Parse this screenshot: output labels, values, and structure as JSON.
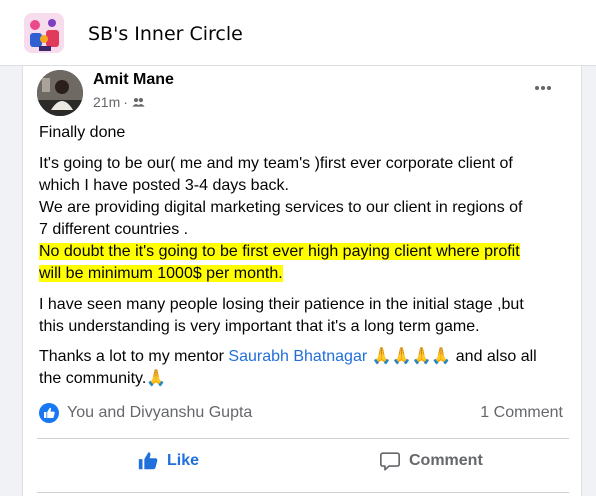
{
  "group": {
    "name": "SB's Inner Circle",
    "logo_icon": "group-illustration-icon"
  },
  "post": {
    "author": "Amit Mane",
    "time": "21m",
    "privacy_icon": "group-members-icon",
    "lines": [
      [
        {
          "t": "Finally done"
        }
      ],
      [
        {
          "t": "It's going to be our( me and my team's )first ever corporate client of"
        }
      ],
      [
        {
          "t": "which I have posted 3-4 days back."
        }
      ],
      [
        {
          "t": "We are providing digital marketing services to our client in regions of"
        }
      ],
      [
        {
          "t": "7 different countries ."
        }
      ],
      [
        {
          "t": "No doubt the it's going to be first ever high paying client where profit",
          "h": true
        }
      ],
      [
        {
          "t": "will be minimum 1000$ per month.",
          "h": true
        }
      ],
      [
        {
          "t": "I have seen many people losing their patience in the initial stage ,but"
        }
      ],
      [
        {
          "t": "this understanding is very important that it's a long term game."
        }
      ],
      [
        {
          "t": "Thanks a lot to my mentor  "
        },
        {
          "t": "Saurabh Bhatnagar",
          "m": true
        },
        {
          "t": "  🙏🙏🙏🙏  and also all"
        }
      ],
      [
        {
          "t": "the community.🙏"
        }
      ]
    ]
  },
  "reactions": {
    "text": "You and Divyanshu Gupta",
    "comments": "1 Comment"
  },
  "actions": {
    "like": "Like",
    "comment": "Comment"
  },
  "colors": {
    "accent": "#216fdb",
    "highlight": "#ffff00",
    "secondary_text": "#65676b"
  }
}
